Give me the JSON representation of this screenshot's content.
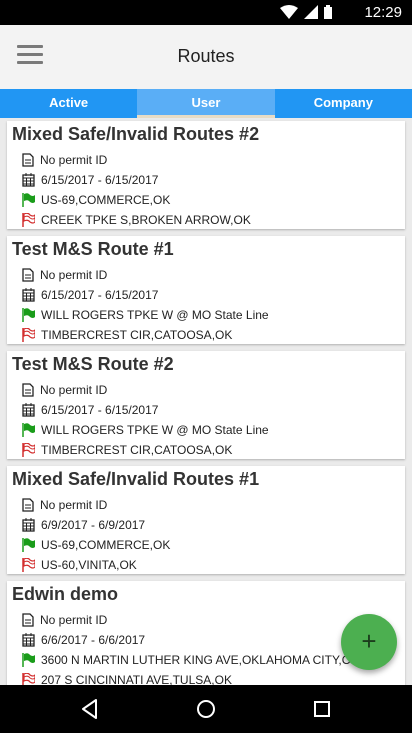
{
  "status_bar": {
    "time": "12:29",
    "icons": [
      "wifi-icon",
      "signal-icon",
      "battery-icon"
    ]
  },
  "app_bar": {
    "title": "Routes",
    "menu_icon": "hamburger-menu-icon"
  },
  "tabs": [
    {
      "label": "Active",
      "selected": false
    },
    {
      "label": "User",
      "selected": true
    },
    {
      "label": "Company",
      "selected": false
    }
  ],
  "routes": [
    {
      "name": "Mixed Safe/Invalid Routes #2",
      "permit": "No permit ID",
      "dates": "6/15/2017 - 6/15/2017",
      "start": "US-69,COMMERCE,OK",
      "end": "CREEK TPKE S,BROKEN ARROW,OK"
    },
    {
      "name": "Test M&S Route #1",
      "permit": "No permit ID",
      "dates": "6/15/2017 - 6/15/2017",
      "start": "WILL ROGERS TPKE W @ MO State Line",
      "end": "TIMBERCREST CIR,CATOOSA,OK"
    },
    {
      "name": "Test M&S Route #2",
      "permit": "No permit ID",
      "dates": "6/15/2017 - 6/15/2017",
      "start": "WILL ROGERS TPKE W @ MO State Line",
      "end": "TIMBERCREST CIR,CATOOSA,OK"
    },
    {
      "name": "Mixed Safe/Invalid Routes #1",
      "permit": "No permit ID",
      "dates": "6/9/2017 - 6/9/2017",
      "start": "US-69,COMMERCE,OK",
      "end": "US-60,VINITA,OK"
    },
    {
      "name": "Edwin demo",
      "permit": "No permit ID",
      "dates": "6/6/2017 - 6/6/2017",
      "start": "3600 N MARTIN LUTHER KING AVE,OKLAHOMA CITY,OK",
      "end": "207 S CINCINNATI AVE,TULSA,OK"
    }
  ],
  "fab": {
    "label": "+",
    "icon": "add-icon"
  },
  "colors": {
    "tab_bar": "#2196f3",
    "fab": "#4caf50",
    "start_flag": "#1a9c1a",
    "end_flag": "#d32f2f"
  }
}
